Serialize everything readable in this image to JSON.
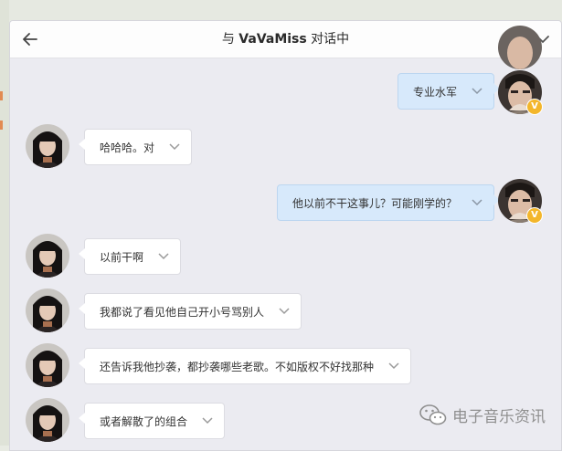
{
  "window": {
    "title_prefix": "与",
    "contact_name": "VaVaMiss",
    "title_suffix": "对话中",
    "back_icon": "back-arrow-icon",
    "menu_icon": "chevron-down-icon"
  },
  "messages": [
    {
      "side": "right",
      "text": "专业水军",
      "verified": "V"
    },
    {
      "side": "left",
      "text": "哈哈哈。对"
    },
    {
      "side": "right",
      "text": "他以前不干这事儿？可能刚学的？",
      "verified": "V"
    },
    {
      "side": "left",
      "text": "以前干啊"
    },
    {
      "side": "left",
      "text": "我都说了看见他自己开小号骂别人"
    },
    {
      "side": "left",
      "text": "还告诉我他抄袭，都抄袭哪些老歌。不如版权不好找那种"
    },
    {
      "side": "left",
      "text": "或者解散了的组合"
    }
  ],
  "watermark": {
    "text": "电子音乐资讯",
    "icon": "wechat-icon"
  },
  "colors": {
    "right_bubble": "#d7e9fb",
    "left_bubble": "#ffffff",
    "badge": "#f3b62b",
    "chat_bg": "#ebebf1"
  }
}
